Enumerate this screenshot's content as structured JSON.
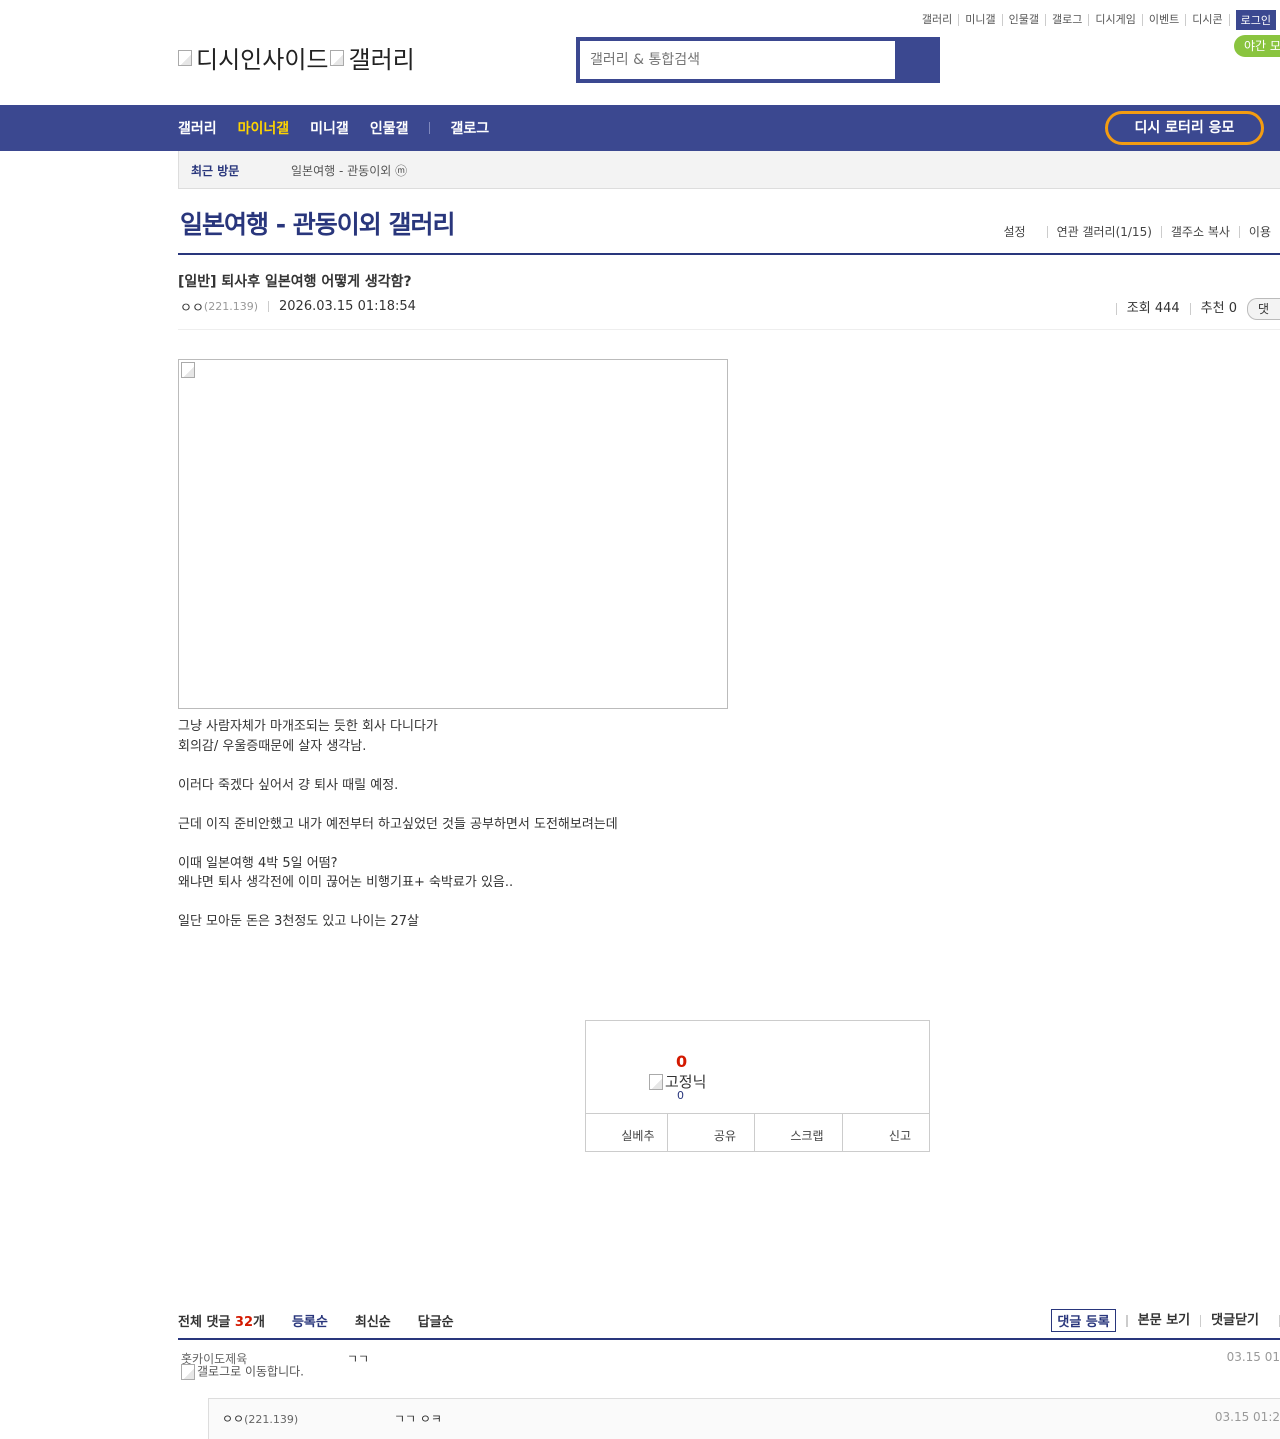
{
  "top_links": [
    "갤러리",
    "미니갤",
    "인물갤",
    "갤로그",
    "디시게임",
    "이벤트",
    "디시콘"
  ],
  "login_label": "로그인",
  "night_mode_label": "야간 모",
  "logo": {
    "site": "디시인사이드",
    "section": "갤러리"
  },
  "search": {
    "placeholder": "갤러리 & 통합검색"
  },
  "nav": {
    "items": [
      "갤러리",
      "마이너갤",
      "미니갤",
      "인물갤"
    ],
    "gallog": "갤로그",
    "active_index": 1,
    "lottery": "디시 로터리 응모"
  },
  "recent": {
    "label": "최근 방문",
    "item": "일본여행 - 관동이외 ⓜ"
  },
  "gallery": {
    "title": "일본여행 - 관동이외 갤러리",
    "menu": [
      "설정",
      "연관 갤러리(1/15)",
      "갤주소 복사",
      "이용"
    ]
  },
  "post": {
    "title": "[일반] 퇴사후 일본여행 어떻게 생각함?",
    "author": "ㅇㅇ",
    "ip": "(221.139)",
    "date": "2026.03.15 01:18:54",
    "views": "조회 444",
    "recommend": "추천 0",
    "comment_pill": "댓",
    "body": [
      "그냥 사람자체가 마개조되는 듯한 회사 다니다가",
      "회의감/ 우울증때문에 살자 생각남.",
      "",
      "이러다 죽겠다 싶어서 걍 퇴사 때릴 예정.",
      "",
      "근데 이직 준비안했고 내가 예전부터 하고싶었던 것들 공부하면서 도전해보려는데",
      "",
      "이때 일본여행 4박 5일 어떰?",
      "왜냐면 퇴사 생각전에 이미 끊어논 비행기표+ 숙박료가 있음..",
      "",
      "일단 모아둔 돈은 3천정도 있고 나이는 27살"
    ]
  },
  "recommend_box": {
    "count": "0",
    "fixed_nick_alt": "고정닉",
    "fixed_count": "0",
    "buttons": [
      "실베추",
      "공유",
      "스크랩",
      "신고"
    ]
  },
  "comments": {
    "label": "전체 댓글",
    "count": "32",
    "unit": "개",
    "sorts": [
      "등록순",
      "최신순",
      "답글순"
    ],
    "actions": [
      "댓글 등록",
      "본문 보기",
      "댓글닫기"
    ],
    "list": [
      {
        "nick": "홋카이도제육",
        "gallog_alt": "갤로그로 이동합니다.",
        "text": "ㄱㄱ",
        "date": "03.15 01"
      },
      {
        "nick": "ㅇㅇ",
        "ip": "(221.139)",
        "text": "ㄱㄱ ㅇㅋ",
        "date": "03.15 01:2"
      }
    ]
  },
  "colors": {
    "brand": "#3b4890",
    "title_blue": "#29367c",
    "active_yellow": "#ffd400",
    "lottery_border": "#f39c12",
    "night_green": "#8ac43f",
    "count_red": "#d31900"
  }
}
